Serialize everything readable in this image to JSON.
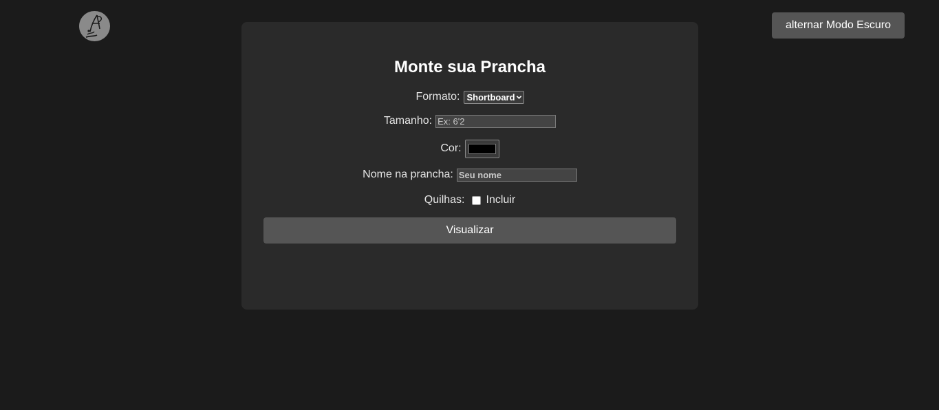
{
  "header": {
    "logo_icon": "surfer-ap-logo",
    "theme_toggle_label": "alternar Modo Escuro"
  },
  "form": {
    "title": "Monte sua Prancha",
    "formato": {
      "label": "Formato:",
      "selected": "Shortboard"
    },
    "tamanho": {
      "label": "Tamanho:",
      "value": "",
      "placeholder": "Ex: 6'2"
    },
    "cor": {
      "label": "Cor:",
      "value": "#000000"
    },
    "nome": {
      "label": "Nome na prancha:",
      "value": "",
      "placeholder": "Seu nome"
    },
    "quilhas": {
      "label": "Quilhas:",
      "checkbox_label": "Incluir",
      "checked": false
    },
    "submit_label": "Visualizar"
  },
  "colors": {
    "page_bg": "#1b1b1b",
    "card_bg": "#2a2a2a",
    "button_bg": "#555555",
    "text": "#e6e6e6"
  }
}
